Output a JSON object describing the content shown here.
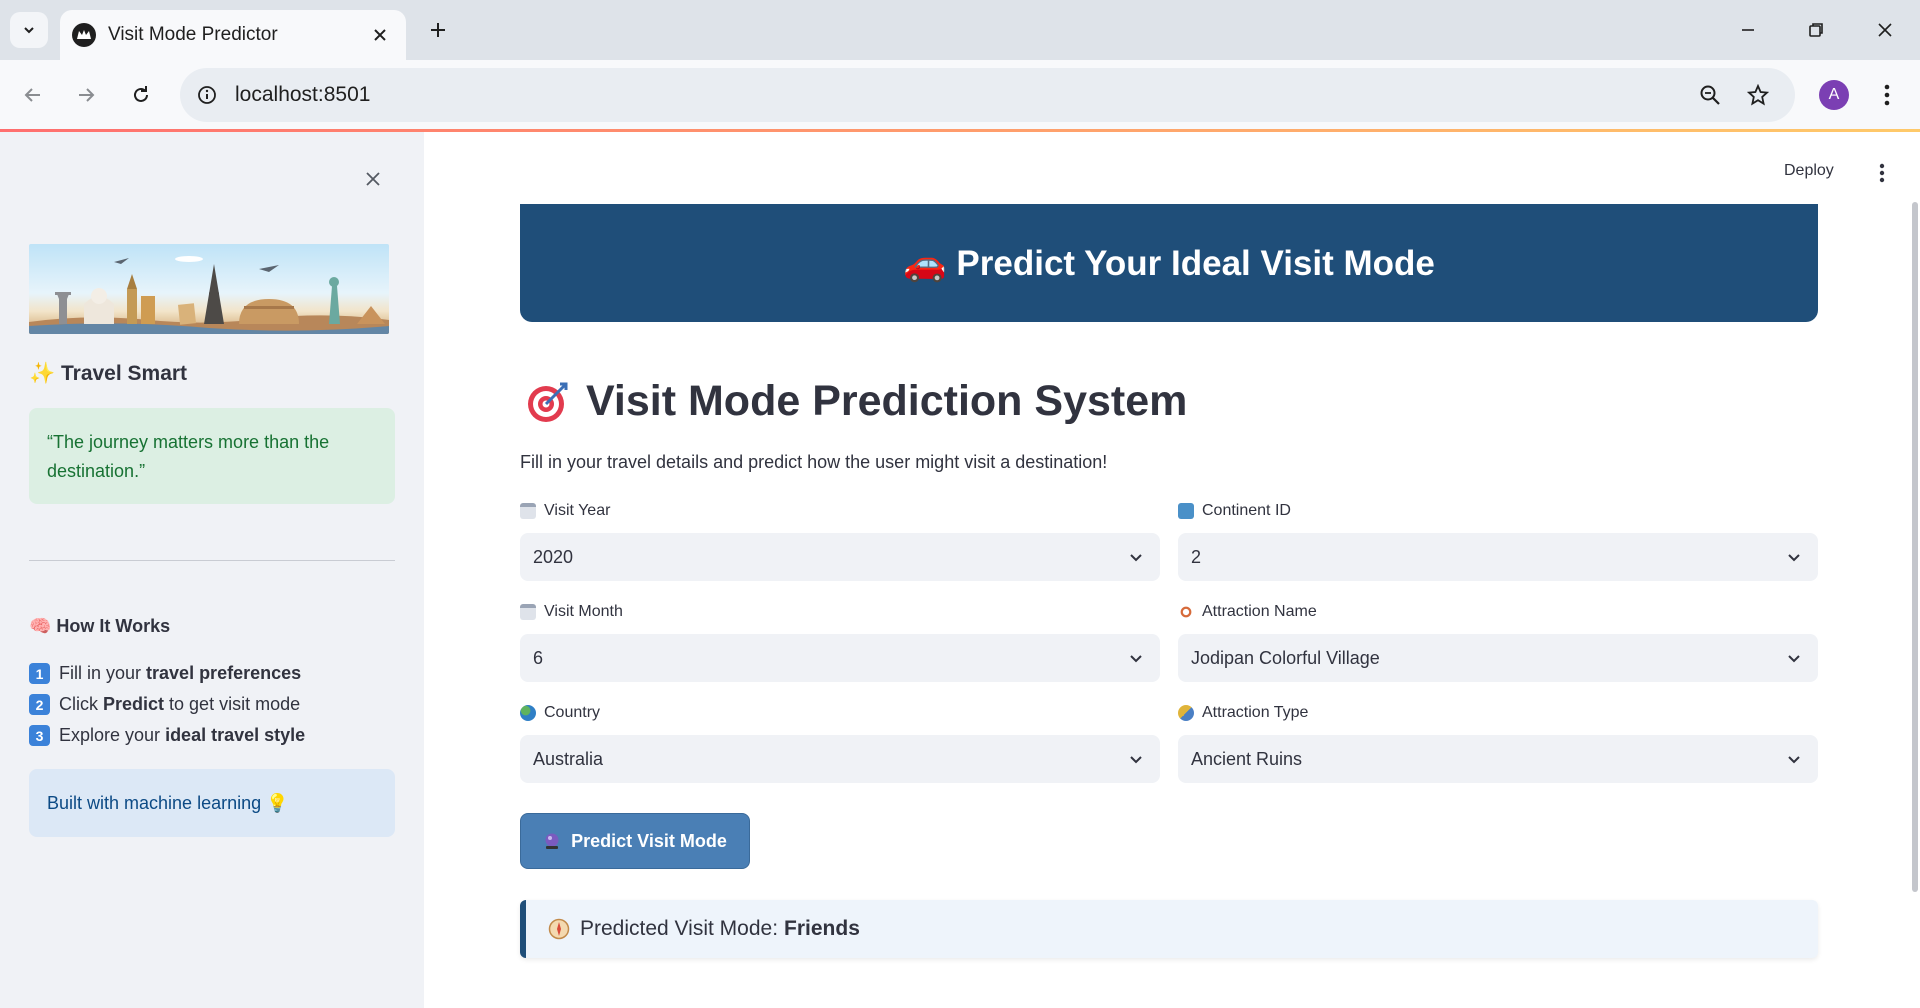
{
  "browser": {
    "tab_title": "Visit Mode Predictor",
    "url": "localhost:8501",
    "avatar_letter": "A"
  },
  "sidebar": {
    "title": "✨ Travel Smart",
    "quote": "“The journey matters more than the destination.”",
    "how_title": "🧠 How It Works",
    "steps": [
      {
        "num": "1",
        "pre": "Fill in your ",
        "bold": "travel preferences",
        "post": ""
      },
      {
        "num": "2",
        "pre": "Click ",
        "bold": "Predict",
        "post": " to get visit mode"
      },
      {
        "num": "3",
        "pre": "Explore your ",
        "bold": "ideal travel style",
        "post": ""
      }
    ],
    "ml_note": "Built with machine learning 💡"
  },
  "header": {
    "deploy_label": "Deploy"
  },
  "main": {
    "hero_title": "🚗 Predict Your Ideal Visit Mode",
    "page_title": "Visit Mode Prediction System",
    "subtitle": "Fill in your travel details and predict how the user might visit a destination!",
    "fields": {
      "visit_year": {
        "label": "Visit Year",
        "value": "2020"
      },
      "continent_id": {
        "label": "Continent ID",
        "value": "2"
      },
      "visit_month": {
        "label": "Visit Month",
        "value": "6"
      },
      "attraction_name": {
        "label": "Attraction Name",
        "value": "Jodipan Colorful Village"
      },
      "country": {
        "label": "Country",
        "value": "Australia"
      },
      "attraction_type": {
        "label": "Attraction Type",
        "value": "Ancient Ruins"
      }
    },
    "predict_button": "Predict Visit Mode",
    "result_label": "Predicted Visit Mode:",
    "result_value": "Friends"
  },
  "colors": {
    "hero_bg": "#1f4e79",
    "button_bg": "#4a7fb5",
    "quote_bg": "#dcefe3",
    "note_bg": "#dce8f6",
    "sidebar_bg": "#f0f2f6"
  }
}
